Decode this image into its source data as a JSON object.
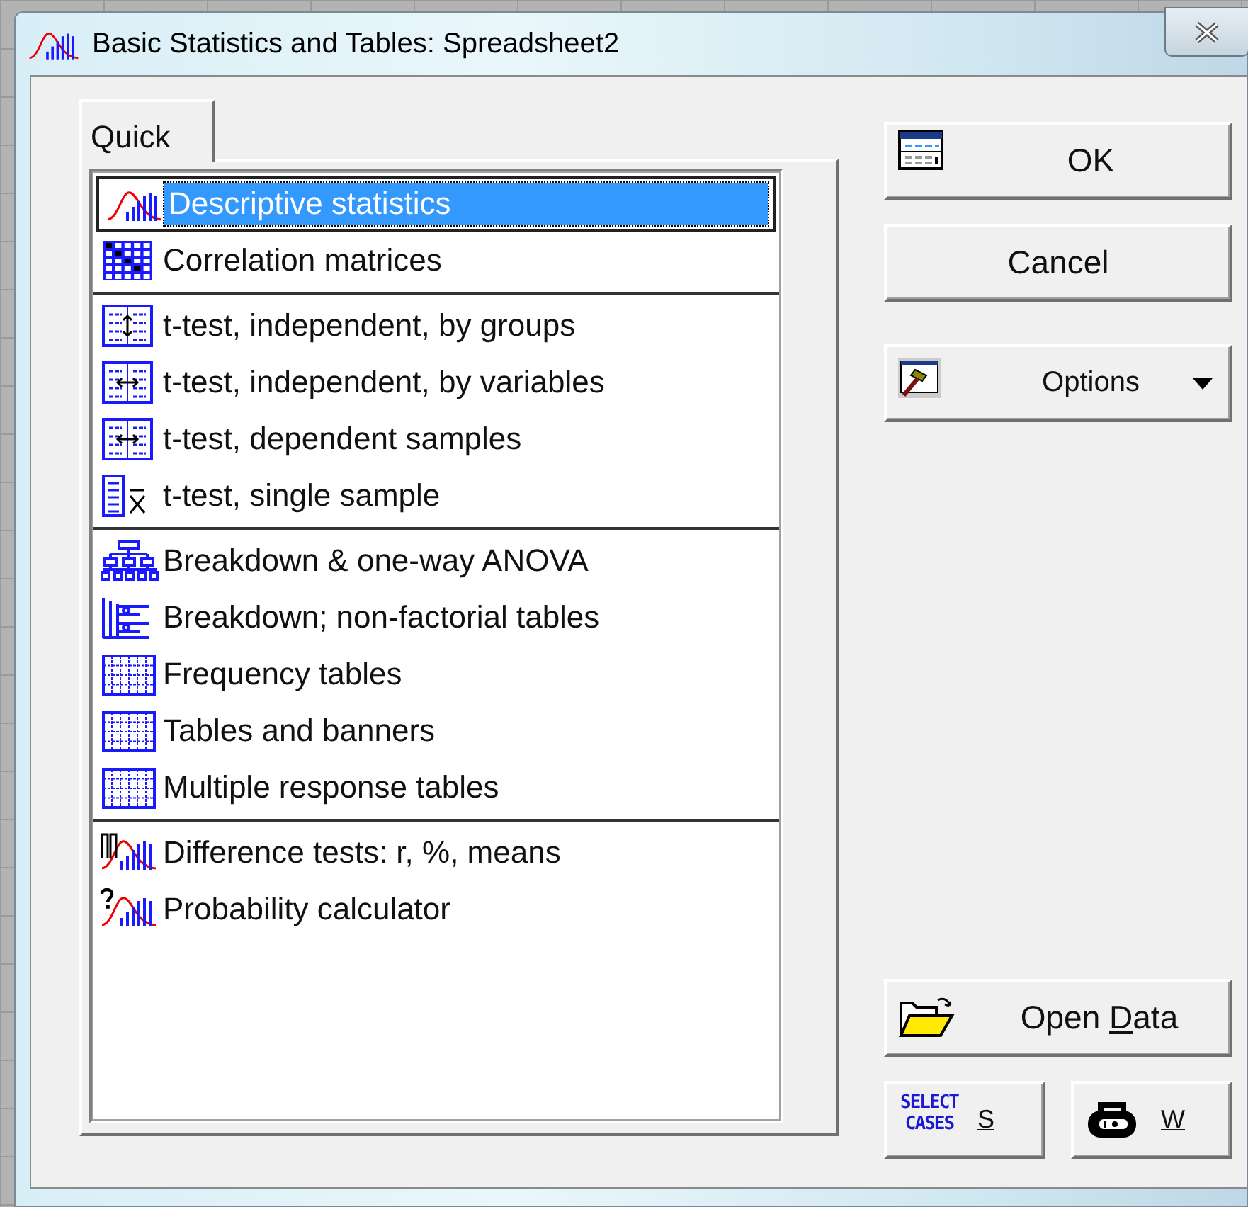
{
  "window": {
    "title": "Basic Statistics and Tables: Spreadsheet2"
  },
  "tabs": [
    {
      "label": "Quick",
      "selected": true
    }
  ],
  "list": {
    "groups": [
      {
        "items": [
          {
            "label": "Descriptive statistics",
            "kind": "distribution",
            "selected": true
          },
          {
            "label": "Correlation matrices",
            "kind": "matrix",
            "selected": false
          }
        ]
      },
      {
        "items": [
          {
            "label": "t-test, independent, by groups",
            "kind": "groups",
            "selected": false
          },
          {
            "label": "t-test, independent, by variables",
            "kind": "variables",
            "selected": false
          },
          {
            "label": "t-test, dependent samples",
            "kind": "dependent",
            "selected": false
          },
          {
            "label": "t-test, single sample",
            "kind": "single",
            "selected": false
          }
        ]
      },
      {
        "items": [
          {
            "label": "Breakdown & one-way ANOVA",
            "kind": "hierarchy",
            "selected": false
          },
          {
            "label": "Breakdown; non-factorial tables",
            "kind": "outline",
            "selected": false
          },
          {
            "label": "Frequency tables",
            "kind": "grid",
            "selected": false
          },
          {
            "label": "Tables and banners",
            "kind": "grid",
            "selected": false
          },
          {
            "label": "Multiple response tables",
            "kind": "grid",
            "selected": false
          }
        ]
      },
      {
        "items": [
          {
            "label": "Difference tests: r, %, means",
            "kind": "difference",
            "selected": false
          },
          {
            "label": "Probability calculator",
            "kind": "probability",
            "selected": false
          }
        ]
      }
    ]
  },
  "buttons_top": [
    {
      "label": "OK",
      "kind": "table"
    },
    {
      "label": "Cancel",
      "kind": "plain"
    },
    {
      "label": "Options",
      "kind": "hammer"
    }
  ],
  "buttons_bottom": [
    {
      "label_parts": [
        {
          "text": "Open ",
          "underlined": false
        },
        {
          "text": "D",
          "underlined": true
        },
        {
          "text": "ata",
          "underlined": false
        }
      ],
      "kind": "folder"
    }
  ],
  "buttons_small": [
    {
      "label_parts": [
        {
          "text": "S",
          "underlined": true
        }
      ],
      "kind": "select",
      "icon_text": "SELECT CASES"
    },
    {
      "label_parts": [
        {
          "text": "W",
          "underlined": true
        }
      ],
      "kind": "weight"
    }
  ]
}
